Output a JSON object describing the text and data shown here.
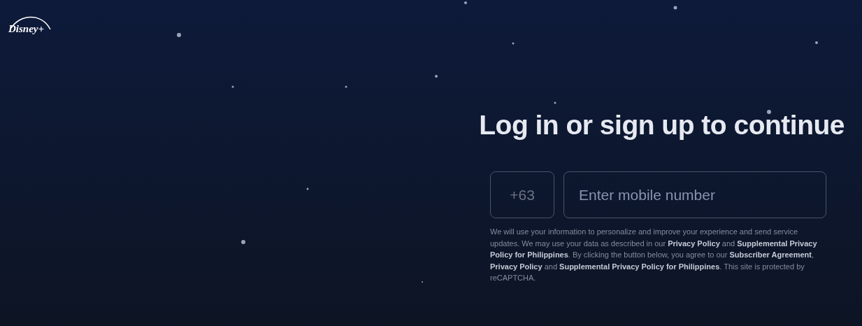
{
  "logo": {
    "text": "Disney+"
  },
  "heading": "Log in or sign up to continue",
  "country_code": {
    "value": "+63"
  },
  "mobile": {
    "placeholder": "Enter mobile number"
  },
  "disclaimer": "We will use your information to personalize and improve your experience and send service updates. We may use your data as described in our **Privacy Policy** and **Supplemental Privacy Policy for Philippines**. By clicking the button below, you agree to our **Subscriber Agreement**, **Privacy Policy** and **Supplemental Privacy Policy for Philippines**. This site is protected by reCAPTCHA."
}
